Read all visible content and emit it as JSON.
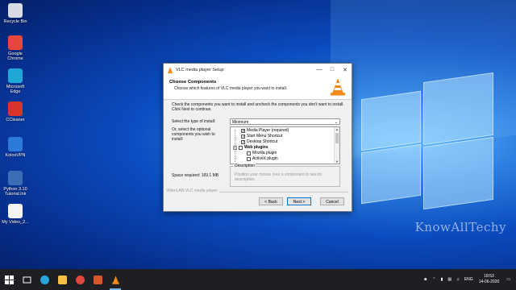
{
  "desktop": {
    "icons": [
      {
        "label": "Recycle Bin",
        "color": "#d8dce4"
      },
      {
        "label": "Google Chrome",
        "color": "#e5473a"
      },
      {
        "label": "Microsoft Edge",
        "color": "#1fa7d8"
      },
      {
        "label": "CCleaner",
        "color": "#d9342b"
      },
      {
        "label": "KoiosVPN",
        "color": "#2b7ad8"
      },
      {
        "label": "Python 3.10 Tutorial.lnk",
        "color": "#3a6db3"
      },
      {
        "label": "My Video_2...",
        "color": "#f4f4f4"
      }
    ],
    "watermark": "KnowAllTechy"
  },
  "dialog": {
    "title": "VLC media player Setup",
    "header_title": "Choose Components",
    "header_subtitle": "Choose which features of VLC media player you want to install.",
    "instructions": "Check the components you want to install and uncheck the components you don't want to install. Click Next to continue.",
    "install_type_label": "Select the type of install:",
    "install_type_value": "Minimum",
    "optional_label": "Or, select the optional components you wish to install:",
    "components": [
      {
        "label": "Media Player (required)",
        "checked": true,
        "bold": false,
        "indent": 1
      },
      {
        "label": "Start Menu Shortcut",
        "checked": true,
        "bold": false,
        "indent": 1
      },
      {
        "label": "Desktop Shortcut",
        "checked": true,
        "bold": false,
        "indent": 1
      },
      {
        "label": "Web plugins",
        "checked": false,
        "bold": true,
        "indent": 0
      },
      {
        "label": "Mozilla plugin",
        "checked": false,
        "bold": false,
        "indent": 2
      },
      {
        "label": "ActiveX plugin",
        "checked": false,
        "bold": false,
        "indent": 2
      }
    ],
    "description_label": "Description",
    "description_hint": "Position your mouse over a component to see its description.",
    "space_required": "Space required: 169.1 MB",
    "branding": "VideoLAN VLC media player",
    "back_button": "< Back",
    "next_button": "Next >",
    "cancel_button": "Cancel"
  },
  "taskbar": {
    "apps": [
      {
        "name": "windows-start",
        "color": "#ffffff"
      },
      {
        "name": "task-view",
        "color": "#ffffff"
      },
      {
        "name": "edge",
        "color": "#2aa6df"
      },
      {
        "name": "file-explorer",
        "color": "#f5c242"
      },
      {
        "name": "chrome",
        "color": "#e5473a"
      },
      {
        "name": "presentation",
        "color": "#d8562b"
      },
      {
        "name": "vlc",
        "color": "#f28a1b"
      }
    ],
    "language": "ENG",
    "time": "18:53",
    "date": "14-06-2020"
  },
  "colors": {
    "accent": "#0078d7",
    "vlc_orange": "#f28a1b"
  }
}
